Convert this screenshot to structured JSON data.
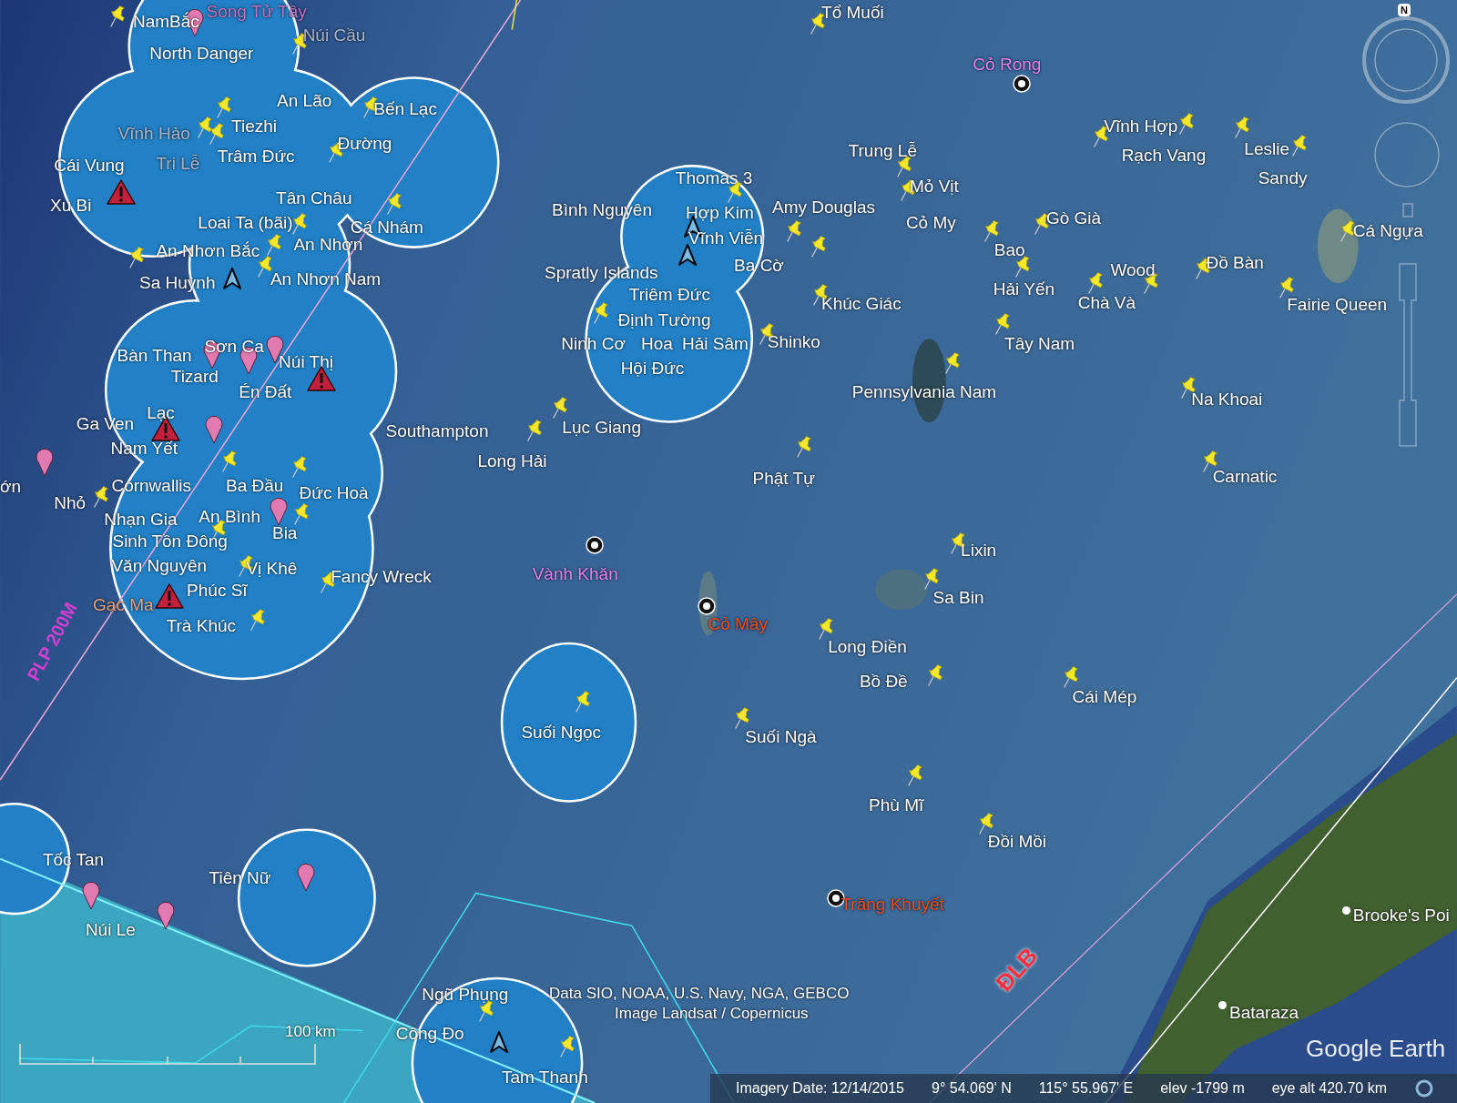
{
  "places": [
    {
      "label": "Song Tử Tây",
      "kind": "balloon",
      "color": "#c070c0"
    },
    {
      "label": "NamBắc",
      "kind": "pushpin",
      "color": "#ffffff"
    },
    {
      "label": "North Danger",
      "kind": "pushpin",
      "color": "#ffffff"
    },
    {
      "label": "Núi Cầu",
      "kind": "none",
      "color": "#a9b4c8"
    },
    {
      "label": "An Lão",
      "kind": "none",
      "color": "#ffffff"
    },
    {
      "label": "Bến Lạc",
      "kind": "pushpin",
      "color": "#ffffff"
    },
    {
      "label": "Vĩnh Hảo",
      "kind": "pushpin",
      "color": "#a9b4c8"
    },
    {
      "label": "Tiezhi",
      "kind": "pushpin",
      "color": "#ffffff"
    },
    {
      "label": "Cái Vung",
      "kind": "none",
      "color": "#ffffff"
    },
    {
      "label": "Tri Lễ",
      "kind": "none",
      "color": "#a9b4c8"
    },
    {
      "label": "Trâm Đức",
      "kind": "pushpin",
      "color": "#ffffff"
    },
    {
      "label": "Đường",
      "kind": "pushpin",
      "color": "#ffffff"
    },
    {
      "label": "Xu Bi",
      "kind": "warning",
      "color": "#ffffff"
    },
    {
      "label": "Tân Châu",
      "kind": "none",
      "color": "#ffffff"
    },
    {
      "label": "Loai Ta (bãi)",
      "kind": "pushpin",
      "color": "#ffffff"
    },
    {
      "label": "Cá Nhám",
      "kind": "pushpin",
      "color": "#ffffff"
    },
    {
      "label": "An Nhơn Bắc",
      "kind": "pushpin",
      "color": "#ffffff"
    },
    {
      "label": "An Nhơn",
      "kind": "pushpin",
      "color": "#ffffff"
    },
    {
      "label": "Sa Huỳnh",
      "kind": "arrow",
      "color": "#ffffff"
    },
    {
      "label": "An Nhơn Nam",
      "kind": "pushpin",
      "color": "#ffffff"
    },
    {
      "label": "Bàn Than",
      "kind": "balloon",
      "color": "#ffffff"
    },
    {
      "label": "Sơn Ca",
      "kind": "balloon",
      "color": "#ffffff"
    },
    {
      "label": "Núi Thị",
      "kind": "balloon",
      "color": "#ffffff"
    },
    {
      "label": "Tizard",
      "kind": "none",
      "color": "#ffffff"
    },
    {
      "label": "Én Đất",
      "kind": "warning",
      "color": "#ffffff"
    },
    {
      "label": "Lạc",
      "kind": "warning",
      "color": "#ffffff"
    },
    {
      "label": "Ga Ven",
      "kind": "balloon",
      "color": "#ffffff"
    },
    {
      "label": "Nam Yết",
      "kind": "none",
      "color": "#ffffff"
    },
    {
      "label": "ớn",
      "kind": "balloon",
      "color": "#ffffff"
    },
    {
      "label": "Nhỏ",
      "kind": "none",
      "color": "#ffffff"
    },
    {
      "label": "Cornwallis",
      "kind": "pushpin",
      "color": "#ffffff"
    },
    {
      "label": "Ba Đầu",
      "kind": "pushpin",
      "color": "#ffffff"
    },
    {
      "label": "Đức Hoà",
      "kind": "pushpin",
      "color": "#ffffff"
    },
    {
      "label": "Nhạn Gia",
      "kind": "none",
      "color": "#ffffff"
    },
    {
      "label": "An Bình",
      "kind": "balloon",
      "color": "#ffffff"
    },
    {
      "label": "Sinh Tồn Đông",
      "kind": "pushpin",
      "color": "#ffffff"
    },
    {
      "label": "Bia",
      "kind": "pushpin",
      "color": "#ffffff"
    },
    {
      "label": "Văn Nguyên",
      "kind": "none",
      "color": "#ffffff"
    },
    {
      "label": "Vị Khê",
      "kind": "pushpin",
      "color": "#ffffff"
    },
    {
      "label": "Fancy Wreck",
      "kind": "pushpin",
      "color": "#ffffff"
    },
    {
      "label": "Phúc Sĩ",
      "kind": "warning",
      "color": "#ffffff"
    },
    {
      "label": "Gạc Ma",
      "kind": "none",
      "color": "#e8a27a"
    },
    {
      "label": "Trà Khúc",
      "kind": "pushpin",
      "color": "#ffffff"
    },
    {
      "label": "Tổ Muối",
      "kind": "pushpin",
      "color": "#ffffff"
    },
    {
      "label": "Cỏ Rong",
      "kind": "target",
      "color": "#e080f0"
    },
    {
      "label": "Vĩnh Hợp",
      "kind": "pushpin",
      "color": "#ffffff"
    },
    {
      "label": "Rạch Vang",
      "kind": "pushpin",
      "color": "#ffffff"
    },
    {
      "label": "Leslie",
      "kind": "pushpin",
      "color": "#ffffff"
    },
    {
      "label": "Sandy",
      "kind": "pushpin",
      "color": "#ffffff"
    },
    {
      "label": "Trung Lễ",
      "kind": "pushpin",
      "color": "#ffffff"
    },
    {
      "label": "Thomas 3",
      "kind": "pushpin",
      "color": "#ffffff"
    },
    {
      "label": "Mỏ Vịt",
      "kind": "pushpin",
      "color": "#ffffff"
    },
    {
      "label": "Bình Nguyên",
      "kind": "none",
      "color": "#ffffff"
    },
    {
      "label": "Hợp Kim",
      "kind": "arrow",
      "color": "#ffffff"
    },
    {
      "label": "Amy Douglas",
      "kind": "pushpin",
      "color": "#ffffff"
    },
    {
      "label": "Cỏ My",
      "kind": "pushpin",
      "color": "#ffffff"
    },
    {
      "label": "Gò Già",
      "kind": "pushpin",
      "color": "#ffffff"
    },
    {
      "label": "Vĩnh Viễn",
      "kind": "arrow",
      "color": "#ffffff"
    },
    {
      "label": "Cá Ngựa",
      "kind": "pushpin",
      "color": "#ffffff"
    },
    {
      "label": "Bao",
      "kind": "none",
      "color": "#ffffff"
    },
    {
      "label": "Ba Cờ",
      "kind": "pushpin",
      "color": "#ffffff"
    },
    {
      "label": "Spratly Islands",
      "kind": "none",
      "color": "#ffffff"
    },
    {
      "label": "Wood",
      "kind": "pushpin",
      "color": "#ffffff"
    },
    {
      "label": "Đồ Bàn",
      "kind": "pushpin",
      "color": "#ffffff"
    },
    {
      "label": "Triêm Đức",
      "kind": "none",
      "color": "#ffffff"
    },
    {
      "label": "Hải Yến",
      "kind": "pushpin",
      "color": "#ffffff"
    },
    {
      "label": "Khúc Giác",
      "kind": "pushpin",
      "color": "#ffffff"
    },
    {
      "label": "Chà Và",
      "kind": "pushpin",
      "color": "#ffffff"
    },
    {
      "label": "Fairie Queen",
      "kind": "pushpin",
      "color": "#ffffff"
    },
    {
      "label": "Định Tường",
      "kind": "pushpin",
      "color": "#ffffff"
    },
    {
      "label": "Ninh Cơ",
      "kind": "none",
      "color": "#ffffff"
    },
    {
      "label": "Hoa",
      "kind": "none",
      "color": "#ffffff"
    },
    {
      "label": "Hải Sâm",
      "kind": "none",
      "color": "#ffffff"
    },
    {
      "label": "Shinko",
      "kind": "pushpin",
      "color": "#ffffff"
    },
    {
      "label": "Tây Nam",
      "kind": "pushpin",
      "color": "#ffffff"
    },
    {
      "label": "Hội Đức",
      "kind": "none",
      "color": "#ffffff"
    },
    {
      "label": "Pennsylvania Nam",
      "kind": "pushpin",
      "color": "#ffffff"
    },
    {
      "label": "Na Khoai",
      "kind": "pushpin",
      "color": "#ffffff"
    },
    {
      "label": "Southampton",
      "kind": "pushpin",
      "color": "#ffffff"
    },
    {
      "label": "Lục Giang",
      "kind": "pushpin",
      "color": "#ffffff"
    },
    {
      "label": "Long Hải",
      "kind": "none",
      "color": "#ffffff"
    },
    {
      "label": "Phật Tự",
      "kind": "pushpin",
      "color": "#ffffff"
    },
    {
      "label": "Carnatic",
      "kind": "pushpin",
      "color": "#ffffff"
    },
    {
      "label": "Lixin",
      "kind": "pushpin",
      "color": "#ffffff"
    },
    {
      "label": "Vành Khăn",
      "kind": "target",
      "color": "#e080f0"
    },
    {
      "label": "Sa Bin",
      "kind": "pushpin",
      "color": "#ffffff"
    },
    {
      "label": "Cỏ Mây",
      "kind": "target",
      "color": "#f04a1a"
    },
    {
      "label": "Long Điền",
      "kind": "pushpin",
      "color": "#ffffff"
    },
    {
      "label": "Bồ Đề",
      "kind": "pushpin",
      "color": "#ffffff"
    },
    {
      "label": "Cái Mép",
      "kind": "pushpin",
      "color": "#ffffff"
    },
    {
      "label": "Suối Ngọc",
      "kind": "pushpin",
      "color": "#ffffff"
    },
    {
      "label": "Suối Ngà",
      "kind": "pushpin",
      "color": "#ffffff"
    },
    {
      "label": "Phù Mĩ",
      "kind": "pushpin",
      "color": "#ffffff"
    },
    {
      "label": "Đồi Mồi",
      "kind": "pushpin",
      "color": "#ffffff"
    },
    {
      "label": "Trăng Khuyết",
      "kind": "target",
      "color": "#f04a1a"
    },
    {
      "label": "Brooke's Poi",
      "kind": "dot",
      "color": "#ffffff"
    },
    {
      "label": "Bataraza",
      "kind": "dot",
      "color": "#ffffff"
    },
    {
      "label": "Tốc Tan",
      "kind": "balloon",
      "color": "#ffffff"
    },
    {
      "label": "Núi Le",
      "kind": "balloon",
      "color": "#ffffff"
    },
    {
      "label": "Tiên Nữ",
      "kind": "balloon",
      "color": "#ffffff"
    },
    {
      "label": "Ngũ Phụng",
      "kind": "pushpin",
      "color": "#ffffff"
    },
    {
      "label": "Công Đo",
      "kind": "arrow",
      "color": "#ffffff"
    },
    {
      "label": "Tam Thanh",
      "kind": "pushpin",
      "color": "#ffffff"
    }
  ],
  "boundary_labels": [
    {
      "label": "PLP 200M",
      "color": "#d040d0"
    },
    {
      "label": "ĐLB",
      "color": "#ff3040"
    }
  ],
  "scale": "100 km",
  "attribution": [
    "Data SIO, NOAA, U.S. Navy, NGA, GEBCO",
    "Image Landsat / Copernicus"
  ],
  "logo": "Google Earth",
  "compass": "N",
  "status_bar": [
    "Imagery Date: 12/14/2015",
    "9° 54.069' N",
    "115° 55.967' E",
    "elev -1799 m",
    "eye alt 420.70 km"
  ]
}
